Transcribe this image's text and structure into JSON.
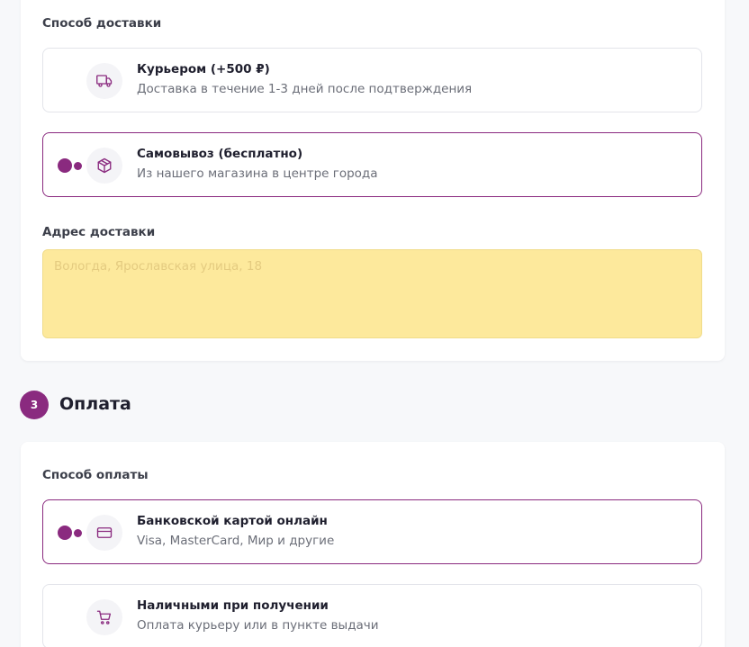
{
  "delivery": {
    "section_label": "Способ доставки",
    "options": [
      {
        "title": "Курьером (+500 ₽)",
        "subtitle": "Доставка в течение 1-3 дней после подтверждения",
        "icon": "truck-icon",
        "selected": false
      },
      {
        "title": "Самовывоз (бесплатно)",
        "subtitle": "Из нашего магазина в центре города",
        "icon": "package-icon",
        "selected": true
      }
    ],
    "address_label": "Адрес доставки",
    "address_placeholder": "Вологда, Ярославская улица, 18",
    "address_value": ""
  },
  "payment_step": {
    "number": "3",
    "title": "Оплата"
  },
  "payment": {
    "section_label": "Способ оплаты",
    "options": [
      {
        "title": "Банковской картой онлайн",
        "subtitle": "Visa, MasterCard, Мир и другие",
        "icon": "credit-card-icon",
        "selected": true
      },
      {
        "title": "Наличными при получении",
        "subtitle": "Оплата курьеру или в пункте выдачи",
        "icon": "cart-icon",
        "selected": false
      }
    ]
  },
  "colors": {
    "accent": "#8a2a7f",
    "address_field_bg": "#fde99c",
    "page_bg": "#f7f8fa",
    "card_bg": "#ffffff"
  }
}
